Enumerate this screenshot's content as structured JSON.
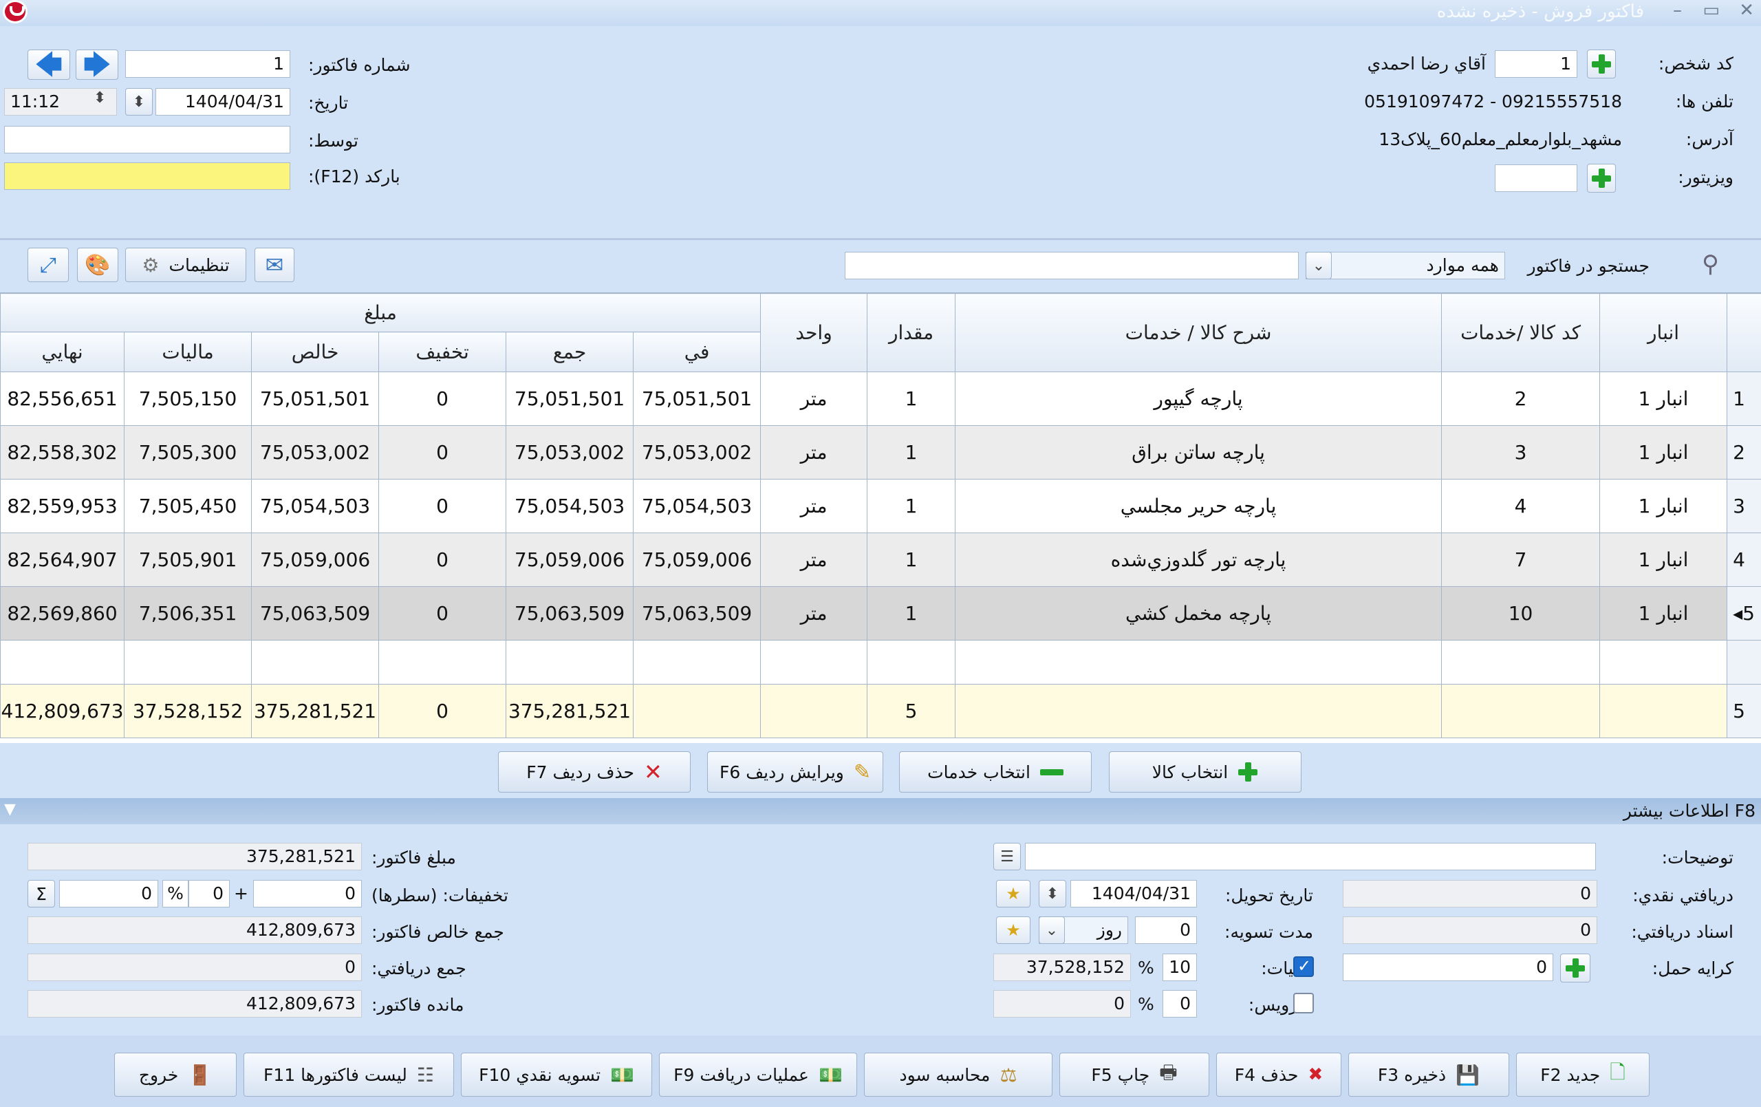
{
  "window": {
    "title": "فاکتور فروش - ذخیره نشده",
    "minimize": "–",
    "restore": "▭",
    "close": "✕"
  },
  "header": {
    "person_code_label": "کد شخص:",
    "person_code": "1",
    "person_name": "آقاي رضا احمدي",
    "phones_label": "تلفن ها:",
    "phones": "05191097472 - 09215557518",
    "address_label": "آدرس:",
    "address": "مشهد_بلوارمعلم_معلم60_پلاک13",
    "visitor_label": "ویزیتور:",
    "visitor": "",
    "invoice_no_label": "شماره فاکتور:",
    "invoice_no": "1",
    "date_label": "تاریخ:",
    "date": "1404/04/31",
    "time": "11:12",
    "by_label": "توسط:",
    "by": "",
    "barcode_label": "بارکد (F12):",
    "barcode": ""
  },
  "toolbar": {
    "search_label": "جستجو در فاکتور",
    "search_scope": "همه موارد",
    "search_value": "",
    "settings_label": "تنظیمات"
  },
  "grid": {
    "headers": {
      "warehouse": "انبار",
      "code": "کد کالا /خدمات",
      "desc": "شرح کالا / خدمات",
      "qty": "مقدار",
      "unit": "واحد",
      "amount": "مبلغ",
      "unit_price": "في",
      "sum": "جمع",
      "discount": "تخفيف",
      "net": "خالص",
      "tax": "ماليات",
      "final": "نهايي"
    },
    "rows": [
      {
        "n": "1",
        "warehouse": "انبار 1",
        "code": "2",
        "desc": "پارچه گیپور",
        "qty": "1",
        "unit": "متر",
        "unit_price": "75,051,501",
        "sum": "75,051,501",
        "discount": "0",
        "net": "75,051,501",
        "tax": "7,505,150",
        "final": "82,556,651"
      },
      {
        "n": "2",
        "warehouse": "انبار 1",
        "code": "3",
        "desc": "پارچه ساتن براق",
        "qty": "1",
        "unit": "متر",
        "unit_price": "75,053,002",
        "sum": "75,053,002",
        "discount": "0",
        "net": "75,053,002",
        "tax": "7,505,300",
        "final": "82,558,302"
      },
      {
        "n": "3",
        "warehouse": "انبار 1",
        "code": "4",
        "desc": "پارچه حریر مجلسي",
        "qty": "1",
        "unit": "متر",
        "unit_price": "75,054,503",
        "sum": "75,054,503",
        "discount": "0",
        "net": "75,054,503",
        "tax": "7,505,450",
        "final": "82,559,953"
      },
      {
        "n": "4",
        "warehouse": "انبار 1",
        "code": "7",
        "desc": "پارچه تور گلدوزي‌شده",
        "qty": "1",
        "unit": "متر",
        "unit_price": "75,059,006",
        "sum": "75,059,006",
        "discount": "0",
        "net": "75,059,006",
        "tax": "7,505,901",
        "final": "82,564,907"
      },
      {
        "n": "◂5",
        "warehouse": "انبار 1",
        "code": "10",
        "desc": "پارچه مخمل کشي",
        "qty": "1",
        "unit": "متر",
        "unit_price": "75,063,509",
        "sum": "75,063,509",
        "discount": "0",
        "net": "75,063,509",
        "tax": "7,506,351",
        "final": "82,569,860"
      }
    ],
    "totals": {
      "n": "5",
      "qty": "5",
      "sum": "375,281,521",
      "discount": "0",
      "net": "375,281,521",
      "tax": "37,528,152",
      "final": "412,809,673"
    }
  },
  "row_actions": {
    "select_goods": "انتخاب کالا",
    "select_services": "انتخاب خدمات",
    "edit_row": "ویرایش ردیف F6",
    "delete_row": "حذف ردیف F7"
  },
  "more_info": {
    "title": "F8 اطلاعات بیشتر",
    "notes_label": "توضیحات:",
    "notes": "",
    "cash_received_label": "دریافتي نقدي:",
    "cash_received": "0",
    "docs_received_label": "اسناد دریافتي:",
    "docs_received": "0",
    "shipping_label": "کرایه حمل:",
    "shipping": "0",
    "delivery_date_label": "تاریخ تحویل:",
    "delivery_date": "1404/04/31",
    "settle_period_label": "مدت تسویه:",
    "settle_period": "0",
    "settle_unit": "روز",
    "tax_label": "ماليات:",
    "tax_percent": "10",
    "tax_amount": "37,528,152",
    "tax_checked": true,
    "service_label": "سرویس:",
    "service_percent": "0",
    "service_amount": "0",
    "service_checked": false,
    "percent_sign": "%",
    "invoice_amount_label": "مبلغ فاکتور:",
    "invoice_amount": "375,281,521",
    "discounts_label": "تخفیفات: (سطرها)",
    "discount_rows": "0",
    "discount_plus": "+",
    "discount_percent": "0",
    "discount_extra": "0",
    "sigma": "Σ",
    "net_total_label": "جمع خالص فاکتور:",
    "net_total": "412,809,673",
    "received_total_label": "جمع دریافتي:",
    "received_total": "0",
    "balance_label": "مانده فاکتور:",
    "balance": "412,809,673"
  },
  "footer": {
    "new": "جدید F2",
    "save": "ذخیره F3",
    "delete": "حذف F4",
    "print": "چاپ F5",
    "profit": "محاسبه سود",
    "receive_ops": "عملیات دریافت F9",
    "cash_settle": "تسویه نقدي F10",
    "invoice_list": "لیست فاکتورها F11",
    "exit": "خروج"
  }
}
